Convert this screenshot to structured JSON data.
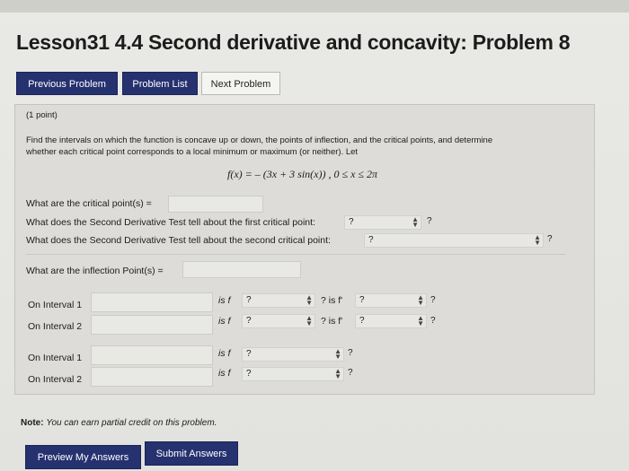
{
  "title": "Lesson31 4.4 Second derivative and concavity: Problem 8",
  "nav": {
    "previous": "Previous Problem",
    "list": "Problem List",
    "next": "Next Problem"
  },
  "problem": {
    "points": "(1 point)",
    "instructions_line1": "Find the intervals on which the function is concave up or down, the points of inflection, and the critical points, and determine",
    "instructions_line2": "whether each critical point corresponds to a local minimum or maximum (or neither). Let",
    "function": "f(x) = – (3x + 3 sin(x)) , 0 ≤ x ≤ 2π",
    "critical_points_label": "What are the critical point(s) =",
    "critical_points_value": "",
    "first_test_label": "What does the Second Derivative Test tell about the first critical point:",
    "first_test_value": "?",
    "first_test_after": "?",
    "second_test_label": "What does the Second Derivative Test tell about the second critical point:",
    "second_test_value": "?",
    "second_test_after": "?",
    "inflection_label": "What are the inflection Point(s) =",
    "inflection_value": ""
  },
  "group1": {
    "rows": [
      {
        "label": "On Interval 1",
        "is_f": "is f",
        "sel1": "?",
        "mid": "? is f'",
        "sel2": "?",
        "after": "?"
      },
      {
        "label": "On Interval 2",
        "is_f": "is f",
        "sel1": "?",
        "mid": "? is f'",
        "sel2": "?",
        "after": "?"
      }
    ]
  },
  "group2": {
    "rows": [
      {
        "label": "On Interval 1",
        "is_f": "is f",
        "sel1": "?",
        "after": "?"
      },
      {
        "label": "On Interval 2",
        "is_f": "is f",
        "sel1": "?",
        "after": "?"
      }
    ]
  },
  "note": {
    "label": "Note:",
    "text": "You can earn partial credit on this problem."
  },
  "buttons": {
    "preview": "Preview My Answers",
    "submit": "Submit Answers"
  },
  "colors": {
    "primary_button": "#26316f",
    "panel": "#dddcd8"
  }
}
